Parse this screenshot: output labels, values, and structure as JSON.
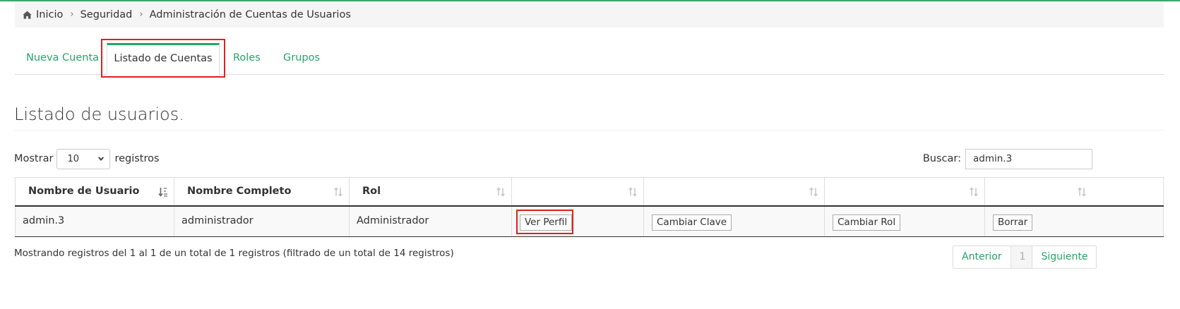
{
  "breadcrumb": {
    "items": [
      "Inicio",
      "Seguridad",
      "Administración de Cuentas de Usuarios"
    ],
    "separator": "›"
  },
  "tabs": [
    {
      "label": "Nueva Cuenta"
    },
    {
      "label": "Listado de Cuentas"
    },
    {
      "label": "Roles"
    },
    {
      "label": "Grupos"
    }
  ],
  "active_tab": "Listado de Cuentas",
  "page": {
    "title": "Listado de usuarios."
  },
  "length": {
    "prefix": "Mostrar",
    "value": "10",
    "suffix": "registros"
  },
  "search": {
    "label": "Buscar:",
    "value": "admin.3"
  },
  "table": {
    "headers": [
      "Nombre de Usuario",
      "Nombre Completo",
      "Rol",
      "",
      "",
      "",
      ""
    ],
    "rows": [
      {
        "username": "admin.3",
        "fullname": "administrador",
        "role": "Administrador",
        "actions": [
          "Ver Perfil",
          "Cambiar Clave",
          "Cambiar Rol",
          "Borrar"
        ]
      }
    ]
  },
  "info": "Mostrando registros del 1 al 1 de un total de 1 registros (filtrado de un total de 14 registros)",
  "pagination": {
    "previous": "Anterior",
    "current": "1",
    "next": "Siguiente"
  },
  "colors": {
    "accent": "#27a36a",
    "highlight": "#e0201f",
    "breadcrumb_bg": "#f5f5f5"
  },
  "icons": {
    "breadcrumb": "home-icon",
    "sort": "sort-icon",
    "sorted": "sort-alpha-asc-icon",
    "select": "chevron-down-icon"
  }
}
